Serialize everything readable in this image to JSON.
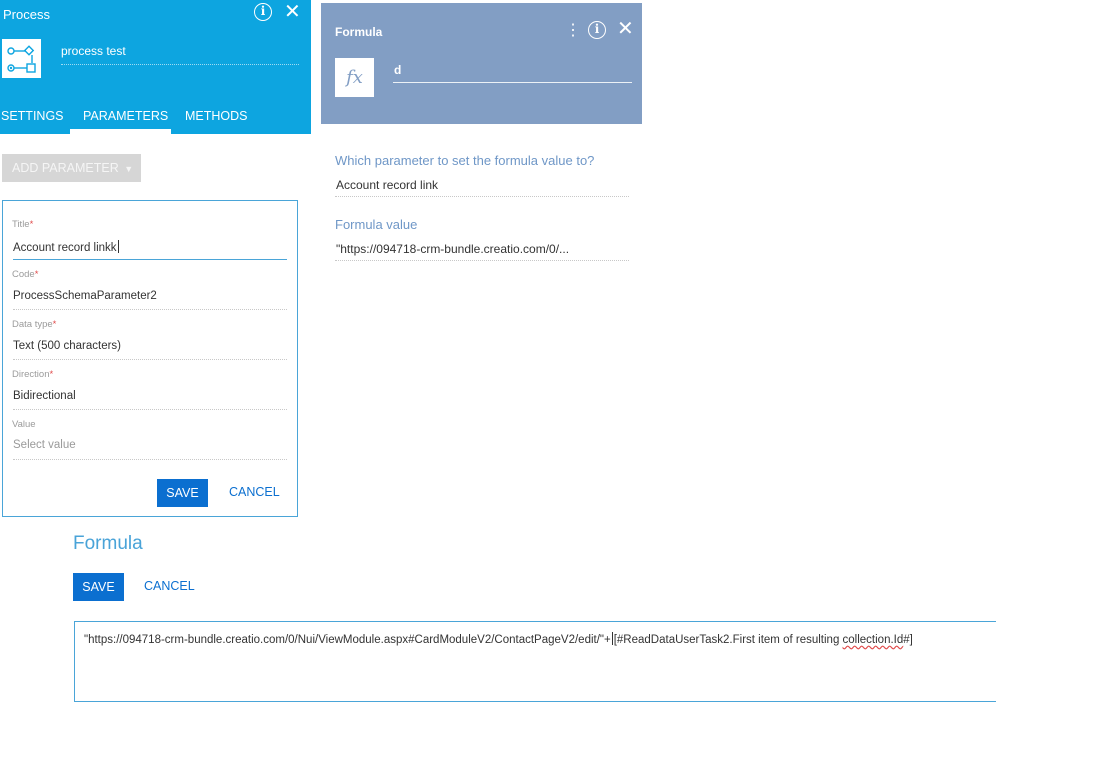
{
  "process_panel": {
    "title": "Process",
    "name": "process test",
    "tabs": [
      {
        "label": "SETTINGS"
      },
      {
        "label": "PARAMETERS",
        "active": true
      },
      {
        "label": "METHODS"
      }
    ],
    "add_parameter_label": "ADD PARAMETER",
    "icons": {
      "info": "info-icon",
      "close": "close-icon",
      "process": "process-flow-icon",
      "dropdown": "caret-down-icon"
    }
  },
  "parameter_form": {
    "title_label": "Title",
    "title_value": "Account record linkk",
    "code_label": "Code",
    "code_value": "ProcessSchemaParameter2",
    "datatype_label": "Data type",
    "datatype_value": "Text (500 characters)",
    "direction_label": "Direction",
    "direction_value": "Bidirectional",
    "value_label": "Value",
    "value_placeholder": "Select value",
    "required_mark": "*",
    "save_label": "SAVE",
    "cancel_label": "CANCEL"
  },
  "formula_dialog": {
    "title": "Formula",
    "value": "d",
    "fx_label": "fx",
    "icons": {
      "more": "more-vertical-icon",
      "info": "info-icon",
      "close": "close-icon"
    },
    "param_question": "Which parameter to set the formula value to?",
    "param_value": "Account record link",
    "formula_value_label": "Formula value",
    "formula_value": "\"https://094718-crm-bundle.creatio.com/0/..."
  },
  "formula_editor": {
    "title": "Formula",
    "save_label": "SAVE",
    "cancel_label": "CANCEL",
    "text_part1": "\"https://094718-crm-bundle.creatio.com/0/Nui/ViewModule.aspx#CardModuleV2/ContactPageV2/edit/\"+",
    "text_part2": "[#ReadDataUserTask2.First item of resulting ",
    "text_misspelled": "collection.Id",
    "text_part3": "#]"
  },
  "colors": {
    "process_header": "#0da5e0",
    "formula_header": "#829ec4",
    "primary_button": "#0b6fd0",
    "accent_label": "#6f97c7",
    "required": "#e04b4b"
  }
}
